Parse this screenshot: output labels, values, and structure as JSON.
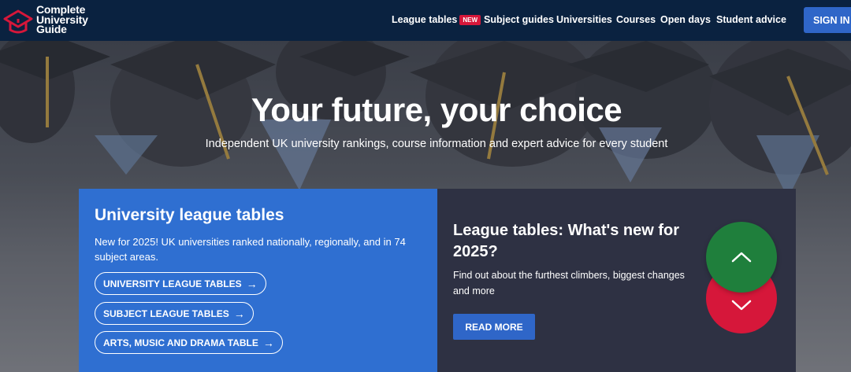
{
  "header": {
    "logo": {
      "line1": "Complete",
      "line2": "University",
      "line3": "Guide",
      "icon": "graduation-cap-icon"
    },
    "nav": [
      {
        "label": "League tables",
        "badge": "NEW"
      },
      {
        "label": "Subject guides"
      },
      {
        "label": "Universities"
      },
      {
        "label": "Courses"
      },
      {
        "label": "Open days"
      },
      {
        "label": "Student advice"
      }
    ],
    "signin_label": "SIGN IN"
  },
  "hero": {
    "title": "Your future, your choice",
    "subtitle": "Independent UK university rankings, course information and expert advice for every student"
  },
  "league_card": {
    "title": "University league tables",
    "description": "New for 2025! UK universities ranked nationally, regionally, and in 74 subject areas.",
    "links": [
      {
        "label": "UNIVERSITY LEAGUE TABLES"
      },
      {
        "label": "SUBJECT LEAGUE TABLES"
      },
      {
        "label": "ARTS, MUSIC AND DRAMA TABLE"
      }
    ],
    "arrow": "→"
  },
  "news_card": {
    "title": "League tables: What's new for 2025?",
    "description": "Find out about the furthest climbers, biggest changes and more",
    "button_label": "READ MORE",
    "up_icon": "chevron-up-icon",
    "down_icon": "chevron-down-icon"
  },
  "colors": {
    "header_bg": "#0a2240",
    "accent_blue": "#2f66c8",
    "card_blue": "#2f6fd1",
    "card_dark": "#2e3143",
    "badge_red": "#d6173a",
    "green": "#1f7f3c"
  }
}
